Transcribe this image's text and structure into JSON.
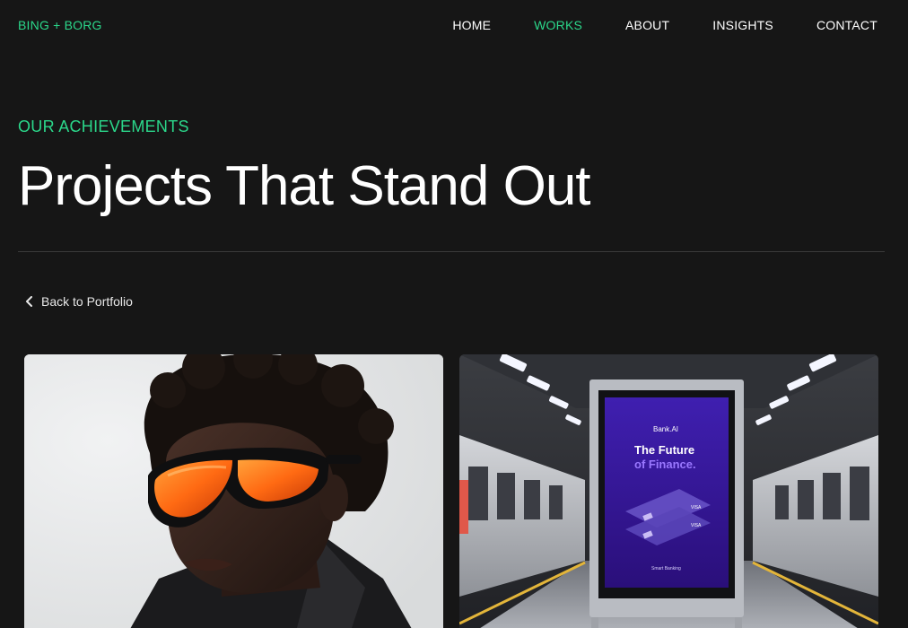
{
  "header": {
    "brand": "BING + BORG",
    "nav": [
      {
        "label": "HOME",
        "active": false
      },
      {
        "label": "WORKS",
        "active": true
      },
      {
        "label": "ABOUT",
        "active": false
      },
      {
        "label": "INSIGHTS",
        "active": false
      },
      {
        "label": "CONTACT",
        "active": false
      }
    ]
  },
  "hero": {
    "eyebrow": "OUR ACHIEVEMENTS",
    "title": "Projects That Stand Out"
  },
  "back_link": {
    "label": "Back to Portfolio",
    "icon": "chevron-left-icon"
  },
  "gallery": {
    "poster": {
      "brand": "Bank.AI",
      "headline_1": "The Future",
      "headline_2": "of Finance.",
      "footer": "Smart Banking",
      "card_label": "VISA"
    }
  },
  "colors": {
    "background": "#161616",
    "accent": "#2bd88b",
    "text": "#ffffff",
    "poster": "#3a1a9a",
    "poster_accent": "#9a78ff",
    "lens": "#ff6a13"
  }
}
